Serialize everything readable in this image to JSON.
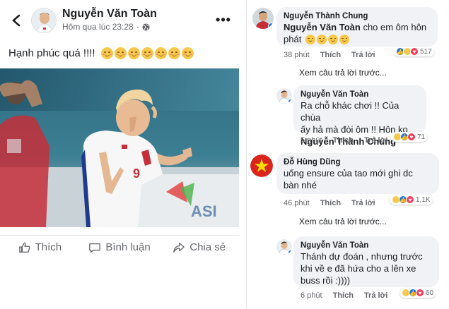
{
  "post": {
    "author": "Nguyễn Văn Toàn",
    "timestamp": "Hôm qua lúc 23:28",
    "privacy_icon": "globe-icon",
    "text": "Hạnh phúc quá !!!!",
    "emoji_count": 7,
    "actions": {
      "like": "Thích",
      "comment": "Bình luận",
      "share": "Chia sẻ"
    }
  },
  "comments": [
    {
      "author": "Nguyễn Thành Chung",
      "text_mention": "Nguyễn Văn Toàn",
      "text_line1_rest": " cho em ôm hôn",
      "text_line2": "phát",
      "time": "38 phút",
      "like": "Thích",
      "reply": "Trả lời",
      "reactions": "517"
    },
    {
      "see_more": "Xem câu trả lời trước..."
    },
    {
      "author": "Nguyễn Văn Toàn",
      "line1": "Ra chỗ khác chơi !! Của chùa",
      "line2": "ấy hả mà đòi ôm !! Hôn ko",
      "mention": "Nguyễn Thành Chung",
      "time": "5 phút",
      "like": "Thích",
      "reply": "Trả lời",
      "reactions": "71"
    },
    {
      "author": "Đỗ Hùng Dũng",
      "line1": "uống ensure của tao mới ghi dc",
      "line2": "bàn nhé",
      "time": "46 phút",
      "like": "Thích",
      "reply": "Trả lời",
      "reactions": "1,1K"
    },
    {
      "see_more": "Xem câu trả lời trước..."
    },
    {
      "author": "Nguyễn Văn Toàn",
      "line1": "Thánh dự đoán , nhưng trước",
      "line2": "khi về e đã hứa cho a lên xe",
      "line3": "buss rồi :))))",
      "time": "6 phút",
      "like": "Thích",
      "reply": "Trả lời",
      "reactions": "60"
    }
  ],
  "colors": {
    "link_blue": "#1877f2",
    "love_red": "#f33e58",
    "haha_yellow": "#f7c84b",
    "bubble_bg": "#f0f2f5"
  }
}
